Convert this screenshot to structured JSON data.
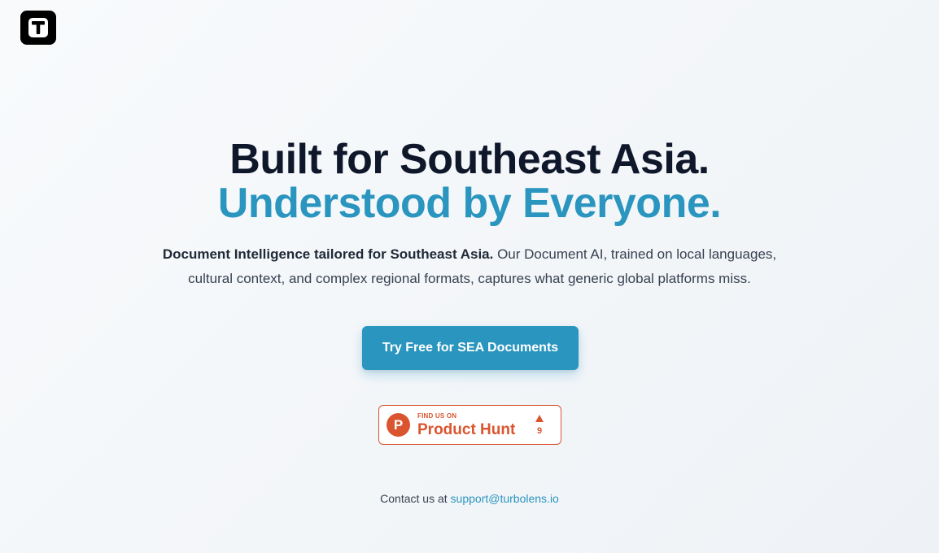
{
  "header": {
    "logo_icon": "t-letter-logo-icon"
  },
  "hero": {
    "headline_line1": "Built for Southeast Asia.",
    "headline_line2": "Understood by Everyone.",
    "subtext_bold": "Document Intelligence tailored for Southeast Asia.",
    "subtext_rest": " Our Document AI, trained on local languages, cultural context, and complex regional formats, captures what generic global platforms miss."
  },
  "cta": {
    "label": "Try Free for SEA Documents"
  },
  "product_hunt": {
    "logo_letter": "P",
    "kicker": "FIND US ON",
    "name": "Product Hunt",
    "votes": "9",
    "arrow_icon": "upvote-arrow-icon"
  },
  "contact": {
    "prefix": "Contact us at ",
    "email": "support@turbolens.io"
  },
  "colors": {
    "accent": "#2a95be",
    "headline": "#0f172a",
    "product_hunt": "#da552f"
  }
}
